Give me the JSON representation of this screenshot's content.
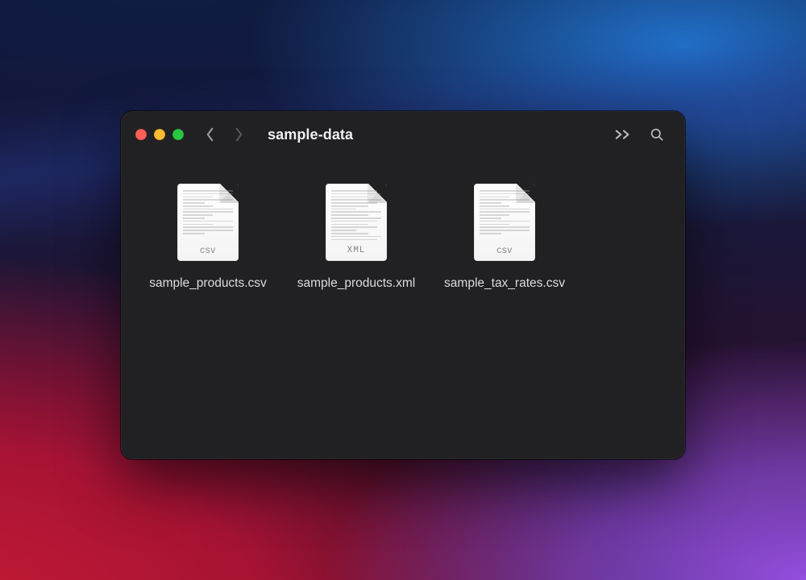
{
  "window": {
    "title": "sample-data"
  },
  "files": [
    {
      "name": "sample_products.csv",
      "type": "csv",
      "badge": "csv"
    },
    {
      "name": "sample_products.xml",
      "type": "xml",
      "badge": "XML"
    },
    {
      "name": "sample_tax_rates.csv",
      "type": "csv",
      "badge": "csv"
    }
  ]
}
